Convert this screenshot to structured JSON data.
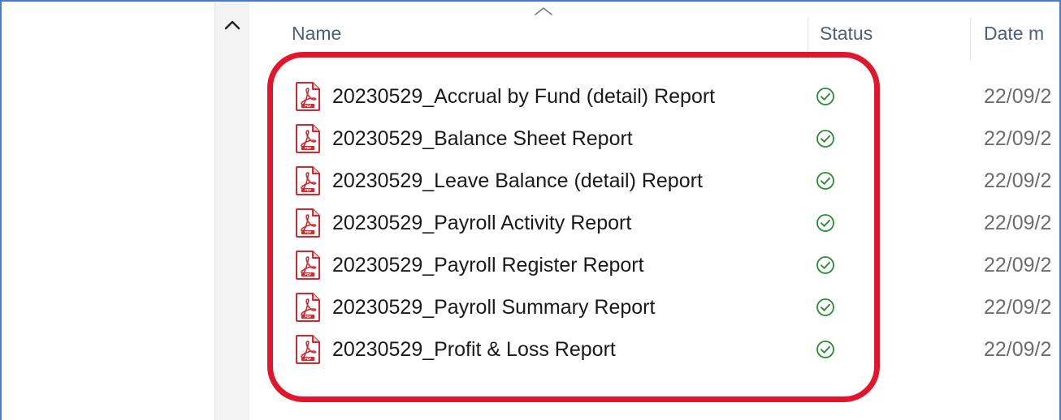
{
  "header": {
    "columns": {
      "name": "Name",
      "status": "Status",
      "date": "Date m"
    }
  },
  "files": [
    {
      "name": "20230529_Accrual by Fund (detail) Report",
      "date": "22/09/2",
      "type_icon": "pdf-icon",
      "status_icon": "synced-check-icon"
    },
    {
      "name": "20230529_Balance Sheet Report",
      "date": "22/09/2",
      "type_icon": "pdf-icon",
      "status_icon": "synced-check-icon"
    },
    {
      "name": "20230529_Leave Balance (detail) Report",
      "date": "22/09/2",
      "type_icon": "pdf-icon",
      "status_icon": "synced-check-icon"
    },
    {
      "name": "20230529_Payroll Activity Report",
      "date": "22/09/2",
      "type_icon": "pdf-icon",
      "status_icon": "synced-check-icon"
    },
    {
      "name": "20230529_Payroll Register Report",
      "date": "22/09/2",
      "type_icon": "pdf-icon",
      "status_icon": "synced-check-icon"
    },
    {
      "name": "20230529_Payroll Summary Report",
      "date": "22/09/2",
      "type_icon": "pdf-icon",
      "status_icon": "synced-check-icon"
    },
    {
      "name": "20230529_Profit & Loss Report",
      "date": "22/09/2",
      "type_icon": "pdf-icon",
      "status_icon": "synced-check-icon"
    }
  ],
  "colors": {
    "window_border": "#4a7bc8",
    "highlight": "#e3152c",
    "status_green": "#2e8b3a",
    "pdf_red": "#d8262d"
  }
}
